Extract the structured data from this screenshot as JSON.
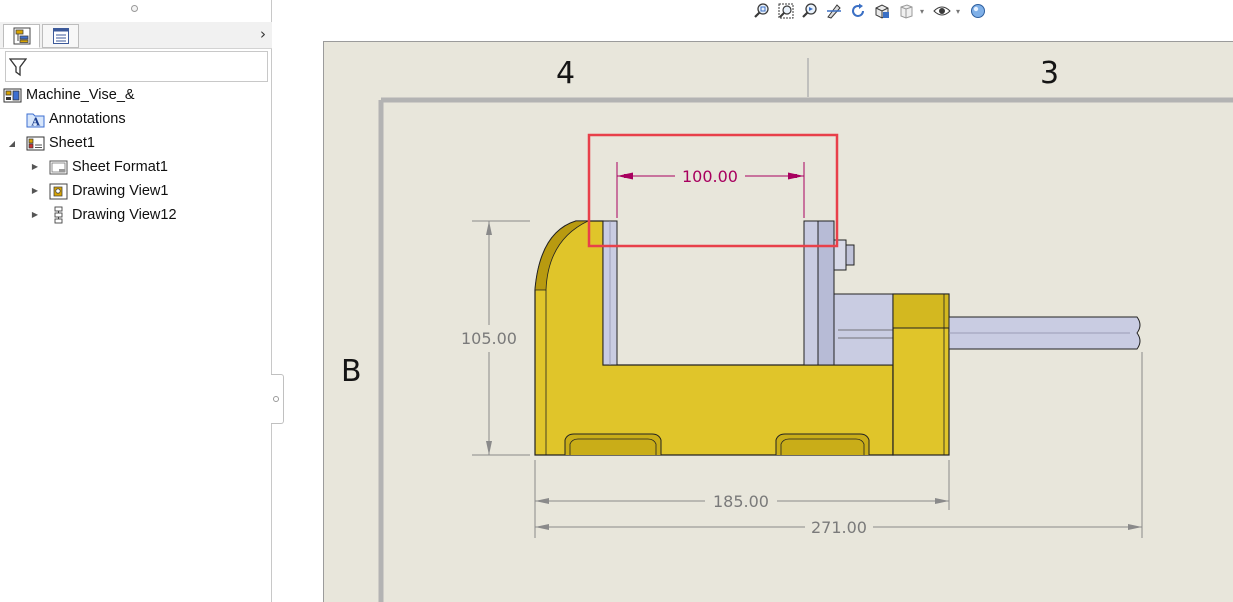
{
  "feature_tree": {
    "root": {
      "label": "Machine_Vise_&"
    },
    "items": [
      {
        "label": "Annotations"
      },
      {
        "label": "Sheet1"
      },
      {
        "label": "Sheet Format1"
      },
      {
        "label": "Drawing View1"
      },
      {
        "label": "Drawing View12"
      }
    ]
  },
  "sheet": {
    "zones": {
      "col_left": "4",
      "col_right": "3",
      "row": "B"
    }
  },
  "dimensions": {
    "jaw_opening": "100.00",
    "height": "105.00",
    "body_length": "185.00",
    "overall_length": "271.00"
  },
  "colors": {
    "sheet_bg": "#e8e6db",
    "part_yellow": "#e0c52a",
    "dimension_selected": "#a8005f",
    "dimension": "#7a7a7a",
    "highlight": "#e8404a"
  },
  "toolbar": {
    "icons": [
      "zoom-to-fit-icon",
      "zoom-to-area-icon",
      "previous-view-icon",
      "section-view-icon",
      "rotate-view-icon",
      "view-orientation-icon",
      "display-style-icon",
      "hide-show-items-icon",
      "edit-appearance-icon"
    ]
  }
}
